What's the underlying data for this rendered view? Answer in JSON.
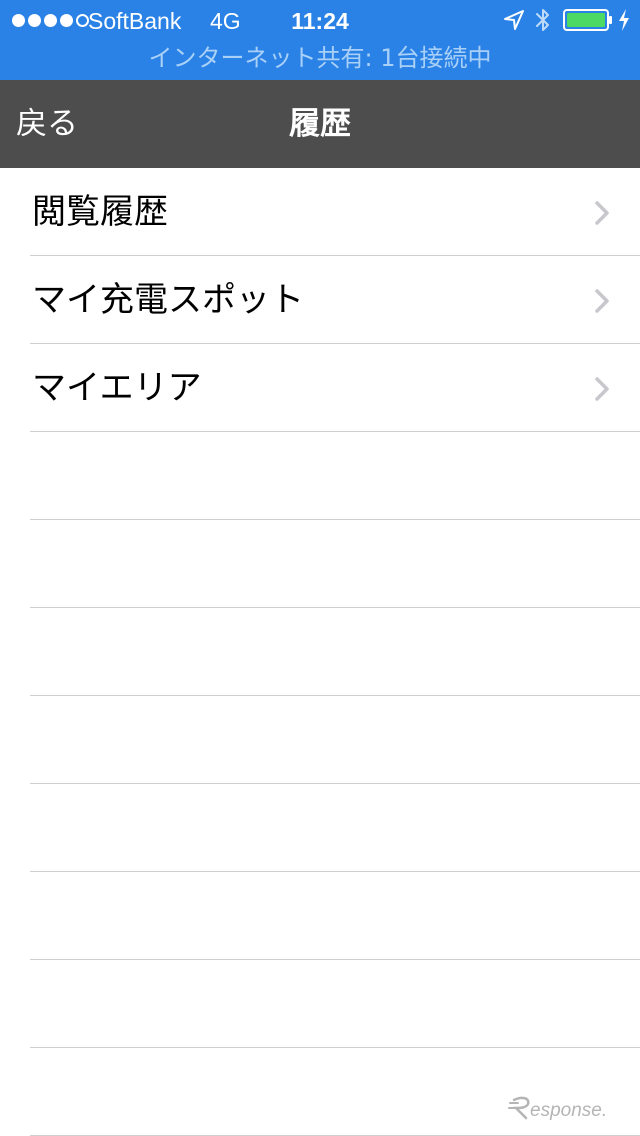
{
  "status_bar": {
    "carrier": "SoftBank",
    "network": "4G",
    "time": "11:24",
    "hotspot_text": "インターネット共有: 1台接続中",
    "signal_dots": [
      true,
      true,
      true,
      true,
      false
    ],
    "icons": [
      "location-icon",
      "bluetooth-icon",
      "battery-icon",
      "charging-icon"
    ],
    "colors": {
      "background": "#2a82e6",
      "battery_fill": "#4cd964",
      "hotspot_text": "#a9d0f7"
    }
  },
  "nav": {
    "back_label": "戻る",
    "title": "履歴",
    "background": "#4d4d4d"
  },
  "list": {
    "items": [
      {
        "label": "閲覧履歴",
        "icon": "chevron-right-icon"
      },
      {
        "label": "マイ充電スポット",
        "icon": "chevron-right-icon"
      },
      {
        "label": "マイエリア",
        "icon": "chevron-right-icon"
      },
      {
        "label": ""
      },
      {
        "label": ""
      },
      {
        "label": ""
      },
      {
        "label": ""
      },
      {
        "label": ""
      },
      {
        "label": ""
      },
      {
        "label": ""
      },
      {
        "label": ""
      }
    ]
  },
  "watermark": {
    "icon": "response-logo",
    "text": "Response."
  }
}
